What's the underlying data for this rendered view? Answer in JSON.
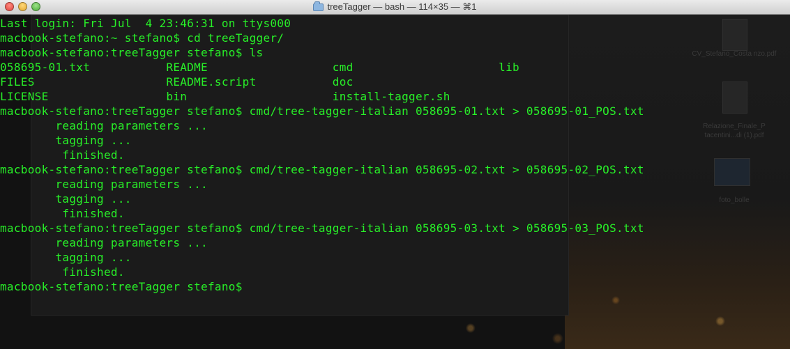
{
  "window": {
    "title": "treeTagger — bash — 114×35 — ⌘1",
    "folder_icon": "folder-icon",
    "controls": [
      "close-button",
      "minimize-button",
      "zoom-button"
    ]
  },
  "colors": {
    "terminal_text": "#28f028",
    "terminal_bg": "#121212"
  },
  "background_desktop": {
    "files": [
      "CV_Stefano_Costa nzo.pdf",
      "Relazione_Finale_P tacentini...di (1).pdf",
      "foto_bolle"
    ]
  },
  "terminal": {
    "lines": [
      "Last login: Fri Jul  4 23:46:31 on ttys000",
      "macbook-stefano:~ stefano$ cd treeTagger/",
      "macbook-stefano:treeTagger stefano$ ls",
      "058695-01.txt           README                  cmd                     lib",
      "FILES                   README.script           doc",
      "LICENSE                 bin                     install-tagger.sh",
      "macbook-stefano:treeTagger stefano$ cmd/tree-tagger-italian 058695-01.txt > 058695-01_POS.txt",
      "        reading parameters ...",
      "        tagging ...",
      "         finished.",
      "macbook-stefano:treeTagger stefano$ cmd/tree-tagger-italian 058695-02.txt > 058695-02_POS.txt",
      "        reading parameters ...",
      "        tagging ...",
      "         finished.",
      "macbook-stefano:treeTagger stefano$ cmd/tree-tagger-italian 058695-03.txt > 058695-03_POS.txt",
      "        reading parameters ...",
      "        tagging ...",
      "         finished.",
      "macbook-stefano:treeTagger stefano$"
    ]
  }
}
